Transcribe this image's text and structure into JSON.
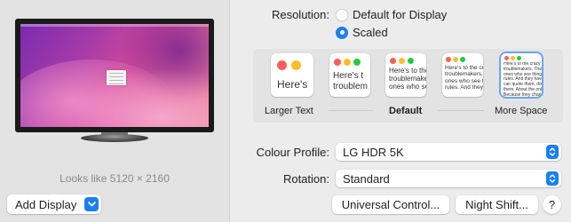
{
  "display": {
    "looks_like": "Looks like 5120 × 2160",
    "add_display_label": "Add Display"
  },
  "resolution": {
    "label": "Resolution:",
    "options": [
      {
        "label": "Default for Display",
        "selected": false
      },
      {
        "label": "Scaled",
        "selected": true
      }
    ]
  },
  "scaling": {
    "thumbnails": [
      {
        "text": "Here's",
        "selected": false
      },
      {
        "text": "Here's t\ntroublem",
        "selected": false
      },
      {
        "text": "Here's to the\ntroublemakers.\nones who see",
        "selected": false
      },
      {
        "text": "Here's to the cr\ntroublemakers.\nones who see th\nrules. And they",
        "selected": false
      },
      {
        "text": "Here's to the crazy one\ntroublemakers. The ro\nones who see things di\nrules. And they have n\ncan quote them, disag\nthem. About the only th\nBecause they change t",
        "selected": true
      }
    ],
    "labels": {
      "larger": "Larger Text",
      "default": "Default",
      "more": "More Space"
    }
  },
  "colour_profile": {
    "label": "Colour Profile:",
    "value": "LG HDR 5K"
  },
  "rotation": {
    "label": "Rotation:",
    "value": "Standard"
  },
  "buttons": {
    "universal_control": "Universal Control...",
    "night_shift": "Night Shift...",
    "help": "?"
  },
  "colors": {
    "accent": "#1a7ff0",
    "close": "#ff5f57",
    "minimize": "#febc2e",
    "zoom": "#28c840"
  },
  "icons": {
    "chevron": "chevron-down-icon",
    "stepper": "up-down-stepper-icon"
  }
}
